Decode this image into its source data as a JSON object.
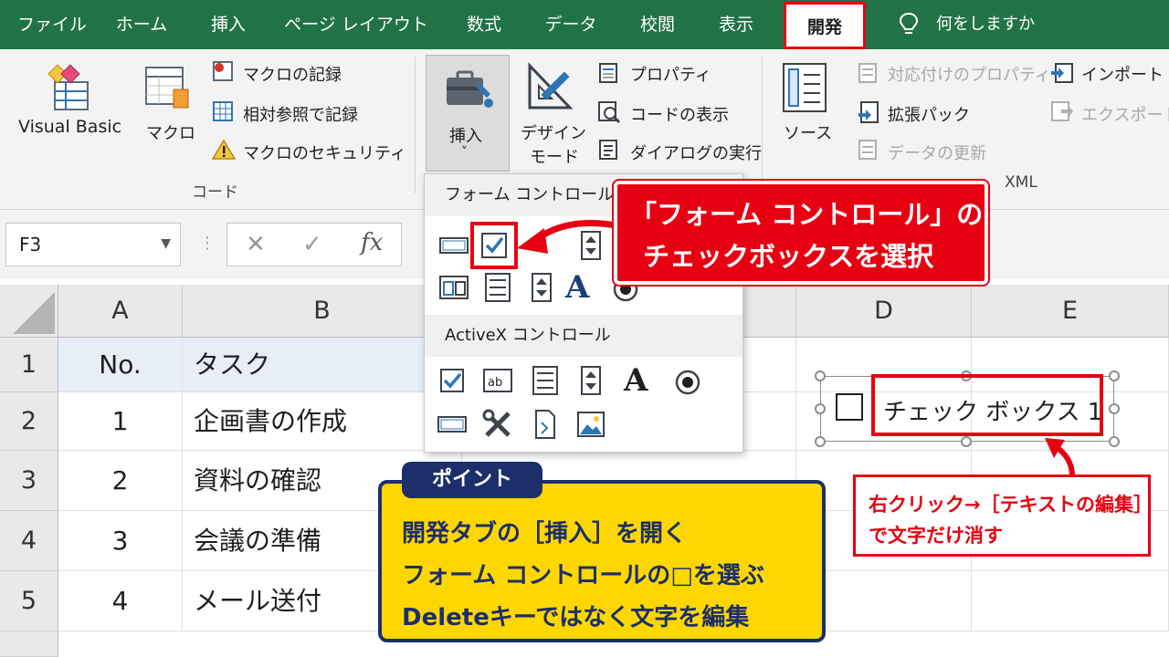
{
  "tabs": [
    {
      "label": "ファイル",
      "active": false
    },
    {
      "label": "ホーム",
      "active": false
    },
    {
      "label": "挿入",
      "active": false
    },
    {
      "label": "ページ レイアウト",
      "active": false
    },
    {
      "label": "数式",
      "active": false
    },
    {
      "label": "データ",
      "active": false
    },
    {
      "label": "校閲",
      "active": false
    },
    {
      "label": "表示",
      "active": false
    },
    {
      "label": "開発",
      "active": true
    }
  ],
  "tell_me": "何をしますか",
  "ribbon": {
    "code_group": {
      "visual_basic": "Visual Basic",
      "macro": "マクロ",
      "record_macro": "マクロの記録",
      "relative_ref": "相対参照で記録",
      "macro_security": "マクロのセキュリティ",
      "group_label": "コード"
    },
    "controls_group": {
      "insert": "挿入",
      "insert_chevron": "˅",
      "design_mode_1": "デザイン",
      "design_mode_2": "モード",
      "properties": "プロパティ",
      "view_code": "コードの表示",
      "run_dialog": "ダイアログの実行"
    },
    "xml_group": {
      "source": "ソース",
      "map_properties": "対応付けのプロパティ",
      "expansion_packs": "拡張パック",
      "refresh_data": "データの更新",
      "import": "インポート",
      "export": "エクスポート",
      "group_label": "XML"
    }
  },
  "formula_bar": {
    "name_box": "F3",
    "cancel": "✕",
    "enter": "✓",
    "fx": "fx",
    "value": ""
  },
  "columns": [
    "A",
    "B",
    "D",
    "E"
  ],
  "rows": [
    {
      "num": "1",
      "a": "No.",
      "b": "タスク"
    },
    {
      "num": "2",
      "a": "1",
      "b": "企画書の作成"
    },
    {
      "num": "3",
      "a": "2",
      "b": "資料の確認"
    },
    {
      "num": "4",
      "a": "3",
      "b": "会議の準備"
    },
    {
      "num": "5",
      "a": "4",
      "b": "メール送付"
    }
  ],
  "dropdown": {
    "form_controls_title": "フォーム コントロール",
    "activex_title": "ActiveX コントロール"
  },
  "checkbox_object": {
    "label": "チェック ボックス 1"
  },
  "callouts": {
    "select_checkbox_line1": "「フォーム コントロール」の",
    "select_checkbox_line2": "チェックボックスを選択",
    "point_tag": "ポイント",
    "point_line1": "開発タブの［挿入］を開く",
    "point_line2": "フォーム コントロールの□を選ぶ",
    "point_line3": "Deleteキーではなく文字を編集",
    "tip_line1": "右クリック→［テキストの編集］",
    "tip_line2": "で文字だけ消す"
  },
  "colors": {
    "excel_green": "#217346",
    "highlight_red": "#e60012",
    "point_yellow": "#ffd700",
    "point_navy": "#1c2f6b"
  }
}
